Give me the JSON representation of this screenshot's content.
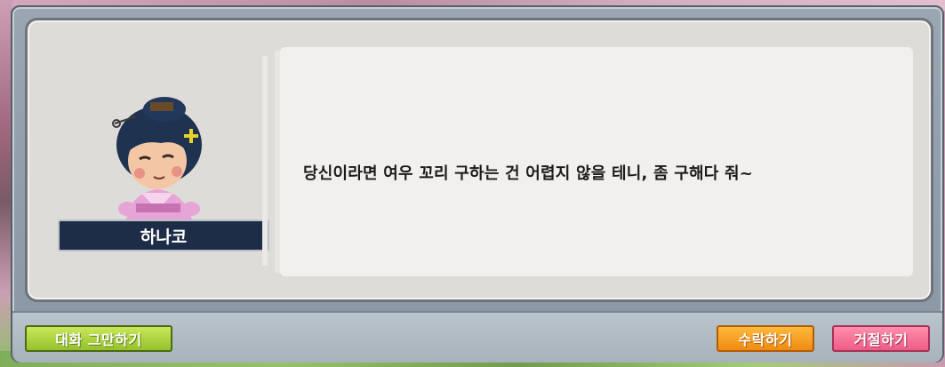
{
  "npc": {
    "name": "하나코"
  },
  "dialog": {
    "message": "당신이라면 여우 꼬리 구하는 건 어렵지 않을 테니, 좀 구해다 줘~"
  },
  "buttons": {
    "end_chat": "대화 그만하기",
    "accept": "수락하기",
    "decline": "거절하기"
  },
  "colors": {
    "end_chat": "#a8d23c",
    "accept": "#f5a123",
    "decline": "#f06f93",
    "nametag": "#1e2d47"
  }
}
